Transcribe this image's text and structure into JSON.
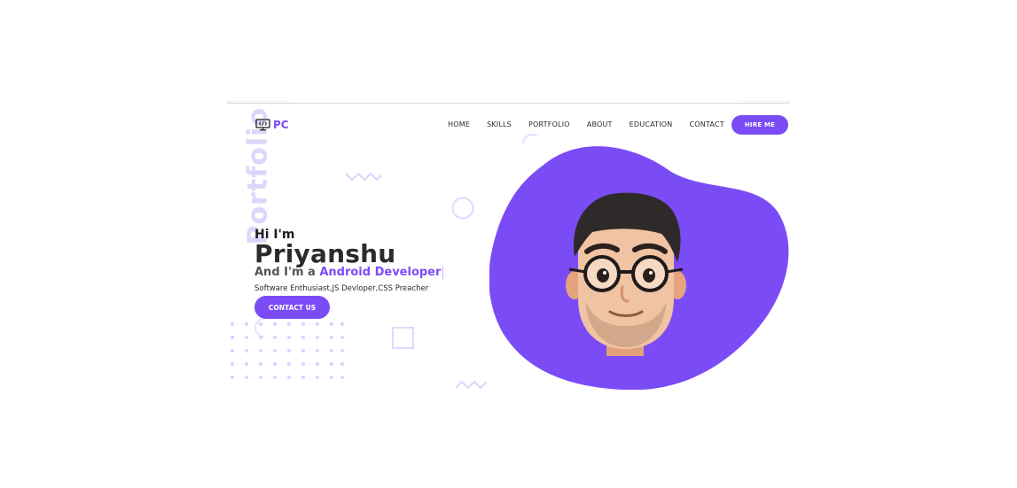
{
  "side_label": "Portfolio",
  "logo": {
    "text": "PC",
    "icon": "monitor-code-icon"
  },
  "nav": {
    "items": [
      "HOME",
      "SKILLS",
      "PORTFOLIO",
      "ABOUT",
      "EDUCATION",
      "CONTACT"
    ],
    "hire_label": "HIRE ME"
  },
  "hero": {
    "greeting": "Hi I'm",
    "name": "Priyanshu",
    "role_prefix": "And I'm a",
    "role_highlight": "Android Developer",
    "tagline": "Software Enthusiast,JS Devloper,CSS Preacher",
    "cta_label": "CONTACT US"
  },
  "colors": {
    "accent": "#7b4cf5",
    "side_label": "#dcd6fb",
    "decoration": "#e2dcfb",
    "text_dark": "#2b2b2b"
  },
  "images": {
    "blob": "purple-blob-shape",
    "avatar": "cartoon-avatar-with-glasses"
  }
}
